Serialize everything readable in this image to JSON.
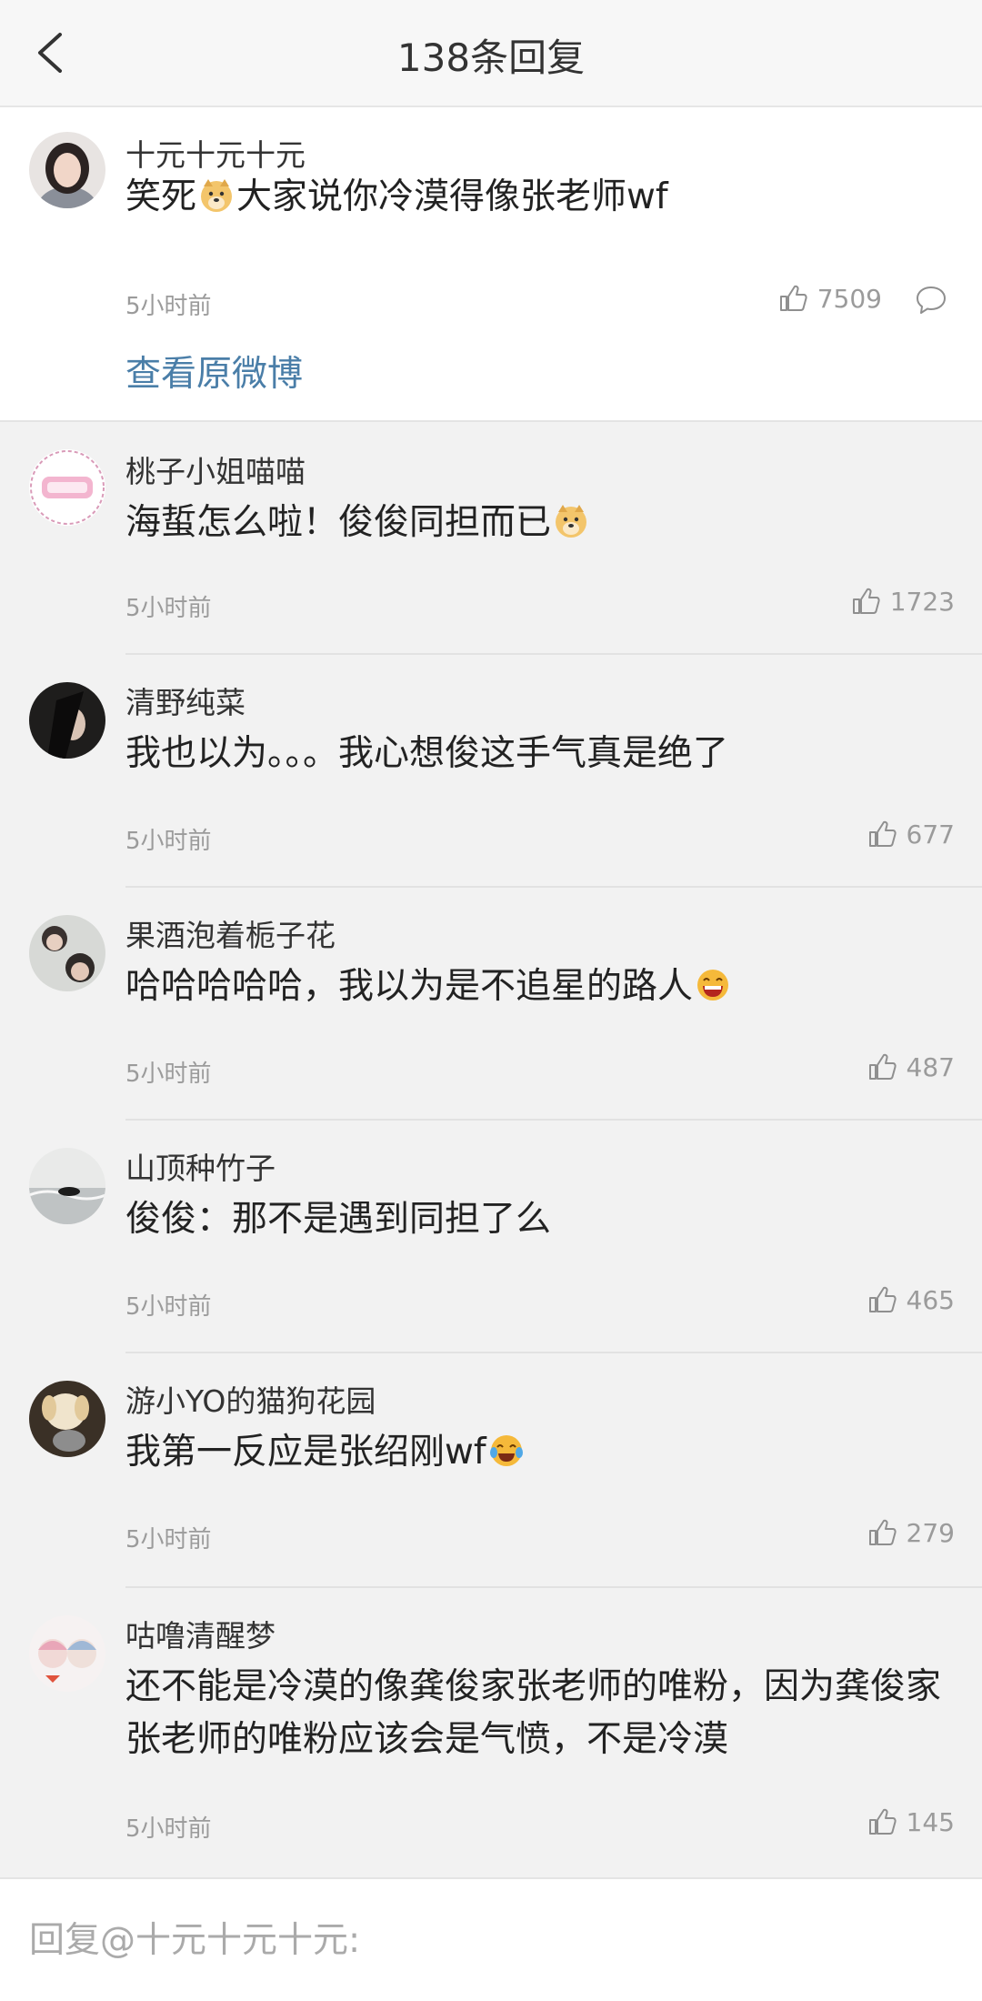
{
  "header": {
    "title": "138条回复",
    "back_icon": "chevron-left-icon"
  },
  "root_comment": {
    "username": "十元十元十元",
    "text_before_emoji": "笑死",
    "emoji": "doge-emoji",
    "text_after_emoji": "大家说你冷漠得像张老师wf",
    "time": "5小时前",
    "likes": "7509",
    "view_original_label": "查看原微博"
  },
  "replies": [
    {
      "username": "桃子小姐喵喵",
      "text": "海蜇怎么啦！俊俊同担而已",
      "emoji": "doge-emoji",
      "time": "5小时前",
      "likes": "1723"
    },
    {
      "username": "清野纯菜",
      "text": "我也以为。。。我心想俊这手气真是绝了",
      "emoji": "",
      "time": "5小时前",
      "likes": "677"
    },
    {
      "username": "果酒泡着栀子花",
      "text": "哈哈哈哈哈，我以为是不追星的路人",
      "emoji": "laughing-emoji",
      "time": "5小时前",
      "likes": "487"
    },
    {
      "username": "山顶种竹子",
      "text": "俊俊：那不是遇到同担了么",
      "emoji": "",
      "time": "5小时前",
      "likes": "465"
    },
    {
      "username": "游小YO的猫狗花园",
      "text": "我第一反应是张绍刚wf",
      "emoji": "tears-of-joy-emoji",
      "time": "5小时前",
      "likes": "279"
    },
    {
      "username": "咕噜清醒梦",
      "text": "还不能是冷漠的像龚俊家张老师的唯粉，因为龚俊家张老师的唯粉应该会是气愤，不是冷漠",
      "emoji": "",
      "time": "5小时前",
      "likes": "145"
    }
  ],
  "reply_box": {
    "placeholder": "回复@十元十元十元:"
  },
  "colors": {
    "link": "#4a7ea8",
    "meta": "#9b9b9b",
    "background": "#f2f2f2"
  }
}
